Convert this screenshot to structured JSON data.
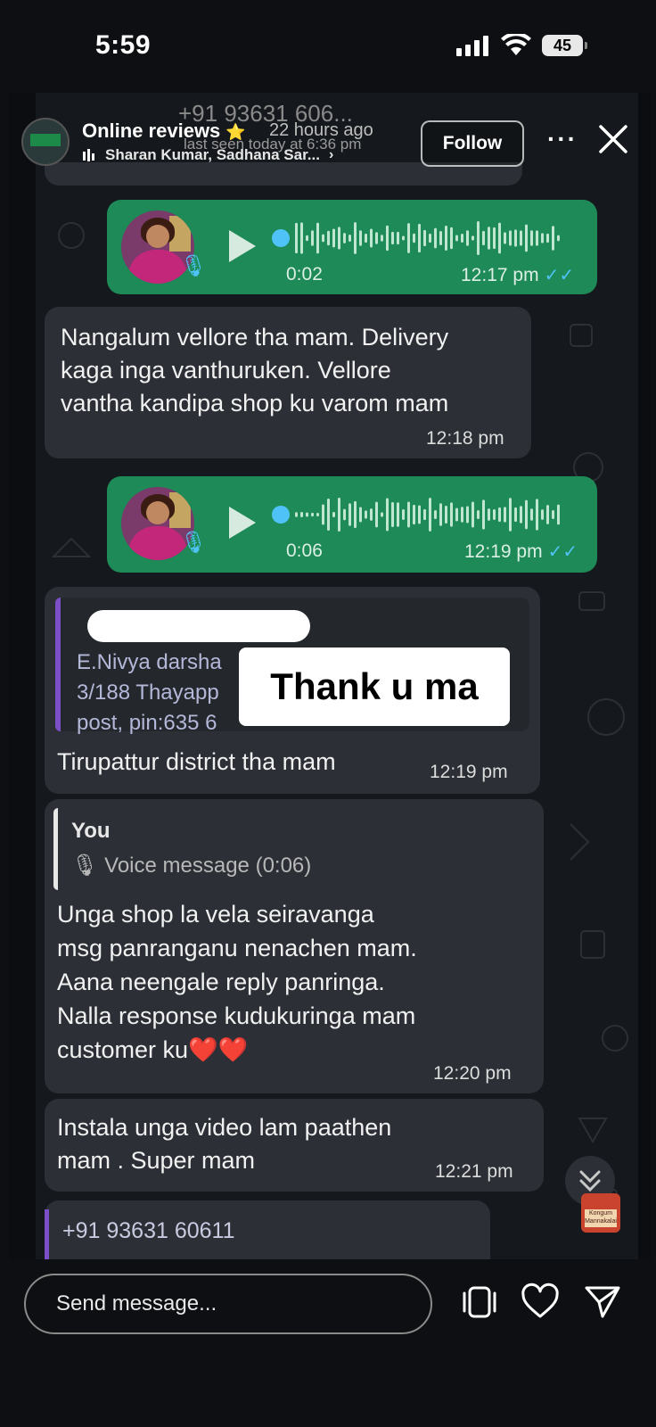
{
  "status_bar": {
    "time": "5:59",
    "battery": "45",
    "icons": [
      "signal-icon",
      "wifi-icon",
      "battery-icon"
    ]
  },
  "story": {
    "progress": 1.0,
    "account_name": "Online reviews",
    "badge_emoji": "⭐",
    "time_ago": "22 hours ago",
    "subtitle": "Sharan Kumar, Sadhana Sar...",
    "follow_label": "Follow",
    "more_label": "···",
    "sticker_text": "Thank u ma"
  },
  "whatsapp": {
    "contact": "+91 93631 606...",
    "last_seen": "last seen today at 6:36 pm",
    "messages": [
      {
        "type": "voice",
        "duration": "0:02",
        "time": "12:17 pm"
      },
      {
        "type": "text",
        "text_lines": [
          "Nangalum vellore tha mam. Delivery",
          "kaga inga vanthuruken. Vellore",
          "vantha kandipa shop ku varom mam"
        ],
        "time": "12:18 pm"
      },
      {
        "type": "voice",
        "duration": "0:06",
        "time": "12:19 pm"
      },
      {
        "type": "quoted",
        "quote_lines": [
          "E.Nivya darsha",
          "3/188 Thayapp",
          "post, pin:635 6"
        ],
        "text": "Tirupattur district tha mam",
        "time": "12:19 pm"
      },
      {
        "type": "reply",
        "reply_to": "You",
        "reply_preview": "Voice message (0:06)",
        "text_lines": [
          "Unga shop la vela seiravanga",
          "msg panranganu nenachen mam.",
          "Aana neengale reply panringa.",
          "Nalla response kudukuringa mam",
          "customer ku❤️❤️"
        ],
        "time": "12:20 pm"
      },
      {
        "type": "text",
        "text_lines": [
          "Instala unga video lam paathen",
          "mam . Super mam"
        ],
        "time": "12:21 pm"
      },
      {
        "type": "partial",
        "text": "+91 93631 60611"
      }
    ]
  },
  "shop_thumb_text": "Kongum Mannakalai",
  "bottom_bar": {
    "placeholder": "Send message...",
    "icons": [
      "reshare-icon",
      "heart-icon",
      "send-icon"
    ]
  },
  "colors": {
    "outgoing_bubble": "#1e8a58",
    "incoming_bubble": "#2c3036",
    "read_ticks": "#4fc3f7",
    "quote_bar": "#7b4fc8"
  }
}
